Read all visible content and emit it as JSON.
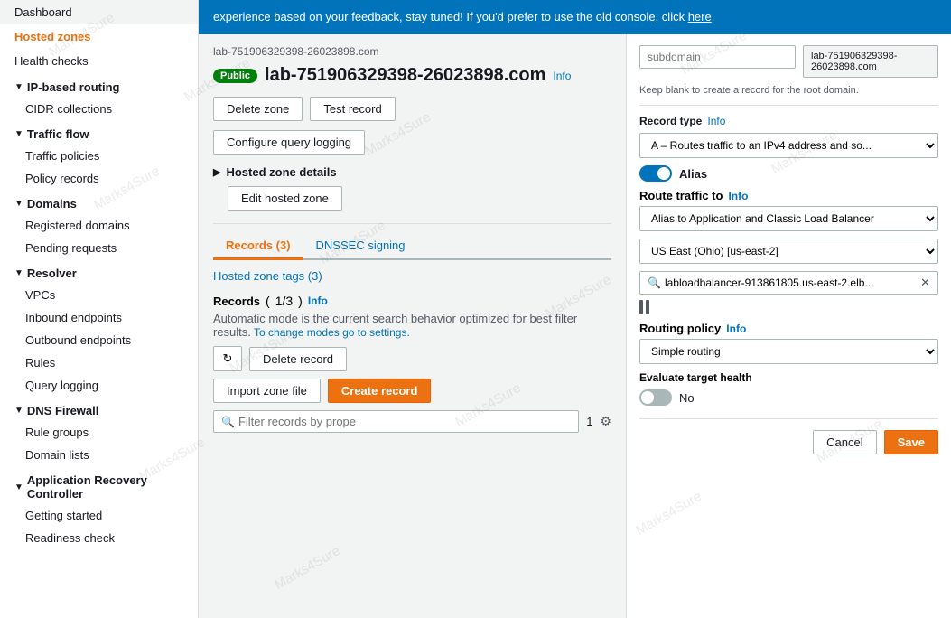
{
  "sidebar": {
    "items": [
      {
        "label": "Dashboard",
        "id": "dashboard",
        "active": false,
        "indent": 0
      },
      {
        "label": "Hosted zones",
        "id": "hosted-zones",
        "active": true,
        "indent": 0
      },
      {
        "label": "Health checks",
        "id": "health-checks",
        "active": false,
        "indent": 0
      },
      {
        "label": "IP-based routing",
        "id": "ip-based-routing",
        "header": true,
        "indent": 0
      },
      {
        "label": "CIDR collections",
        "id": "cidr-collections",
        "active": false,
        "indent": 1
      },
      {
        "label": "Traffic flow",
        "id": "traffic-flow",
        "header": true,
        "indent": 0
      },
      {
        "label": "Traffic policies",
        "id": "traffic-policies",
        "active": false,
        "indent": 1
      },
      {
        "label": "Policy records",
        "id": "policy-records",
        "active": false,
        "indent": 1
      },
      {
        "label": "Domains",
        "id": "domains",
        "header": true,
        "indent": 0
      },
      {
        "label": "Registered domains",
        "id": "registered-domains",
        "active": false,
        "indent": 1
      },
      {
        "label": "Pending requests",
        "id": "pending-requests",
        "active": false,
        "indent": 1
      },
      {
        "label": "Resolver",
        "id": "resolver",
        "header": true,
        "indent": 0
      },
      {
        "label": "VPCs",
        "id": "vpcs",
        "active": false,
        "indent": 1
      },
      {
        "label": "Inbound endpoints",
        "id": "inbound-endpoints",
        "active": false,
        "indent": 1
      },
      {
        "label": "Outbound endpoints",
        "id": "outbound-endpoints",
        "active": false,
        "indent": 1
      },
      {
        "label": "Rules",
        "id": "rules",
        "active": false,
        "indent": 1
      },
      {
        "label": "Query logging",
        "id": "query-logging",
        "active": false,
        "indent": 1
      },
      {
        "label": "DNS Firewall",
        "id": "dns-firewall",
        "header": true,
        "indent": 0
      },
      {
        "label": "Rule groups",
        "id": "rule-groups",
        "active": false,
        "indent": 1
      },
      {
        "label": "Domain lists",
        "id": "domain-lists",
        "active": false,
        "indent": 1
      },
      {
        "label": "Application Recovery Controller",
        "id": "arc",
        "header": true,
        "indent": 0
      },
      {
        "label": "Getting started",
        "id": "getting-started",
        "active": false,
        "indent": 1
      },
      {
        "label": "Readiness check",
        "id": "readiness-check",
        "active": false,
        "indent": 1
      }
    ]
  },
  "banner": {
    "text": "experience based on your feedback, stay tuned! If you'd prefer to use the old console, click",
    "link_text": "here"
  },
  "breadcrumb": "lab-751906329398-26023898.com",
  "zone": {
    "badge": "Public",
    "name": "lab-751906329398-26023898.com",
    "info_label": "Info"
  },
  "buttons": {
    "delete_zone": "Delete zone",
    "test_record": "Test record",
    "configure_query_logging": "Configure query logging",
    "hosted_zone_details": "Hosted zone details",
    "edit_hosted_zone": "Edit hosted zone"
  },
  "tabs": [
    {
      "label": "Records (3)",
      "active": true
    },
    {
      "label": "DNSSEC signing",
      "active": false
    }
  ],
  "hosted_zone_tags": "Hosted zone tags (3)",
  "records": {
    "title": "Records",
    "count": "1/3",
    "info_label": "Info",
    "auto_mode_note": "Automatic mode is the current search behavior optimized for best filter results.",
    "change_modes_link": "To change modes go to settings.",
    "toolbar": {
      "refresh_icon": "↻",
      "delete_record": "Delete record",
      "import_zone_file": "Import zone file",
      "create_record": "Create record"
    },
    "search_placeholder": "Filter records by prope",
    "page": "1"
  },
  "right_panel": {
    "subdomain_placeholder": "subdomain",
    "domain_value": "lab-751906329398-26023898.com",
    "keep_blank_note": "Keep blank to create a record for the root domain.",
    "record_type_label": "Record type",
    "record_type_info": "Info",
    "record_type_value": "A – Routes traffic to an IPv4 address and so...",
    "alias_label": "Alias",
    "alias_enabled": true,
    "route_traffic_label": "Route traffic to",
    "route_traffic_info": "Info",
    "route_traffic_options": [
      "Alias to Application and Classic Load Balancer",
      "US East (Ohio) [us-east-2]",
      "labloadbalancer-913861805.us-east-2.elb..."
    ],
    "routing_policy_label": "Routing policy",
    "routing_policy_info": "Info",
    "routing_policy_value": "Simple routing",
    "evaluate_target_health_label": "Evaluate target health",
    "evaluate_no_label": "No",
    "cancel_label": "Cancel",
    "save_label": "Save"
  }
}
